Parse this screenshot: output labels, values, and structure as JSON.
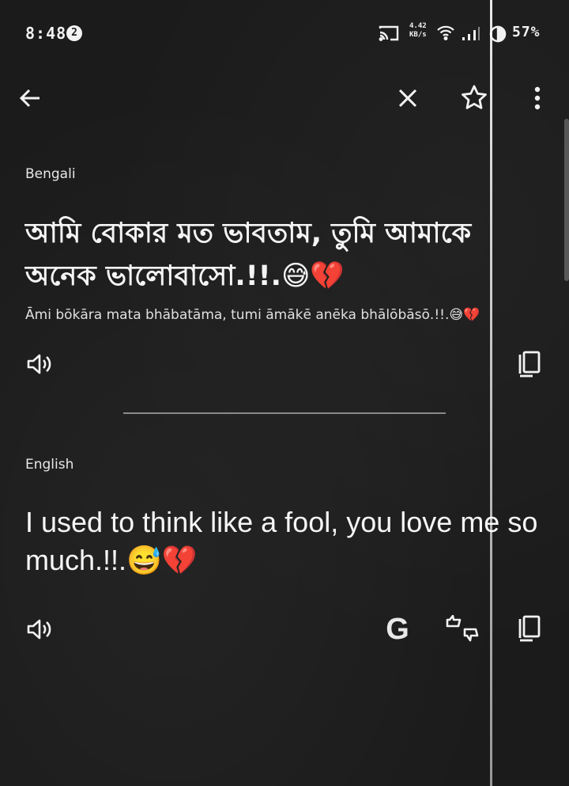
{
  "status_bar": {
    "time": "8:48",
    "notification_count": "2",
    "net_speed_value": "4.42",
    "net_speed_unit": "KB/s",
    "battery": "57%"
  },
  "app_bar": {
    "back_icon": "arrow-back-icon",
    "close_icon": "close-icon",
    "star_icon": "star-outline-icon",
    "more_icon": "more-vert-icon"
  },
  "source": {
    "language": "Bengali",
    "text": "আমি বোকার মত ভাবতাম, তুমি আমাকে অনেক ভালোবাসো.!!.😅💔",
    "transliteration": "Āmi bōkāra mata bhābatāma, tumi āmākē anēka bhālōbāsō.!!.😅💔"
  },
  "target": {
    "language": "English",
    "text": "I used to think like a fool, you love me so much.!!.😅💔"
  },
  "actions": {
    "google_label": "G"
  },
  "colors": {
    "background": "#1b1b1b",
    "text": "#f2f2f2",
    "divider": "#8a8a8a"
  }
}
